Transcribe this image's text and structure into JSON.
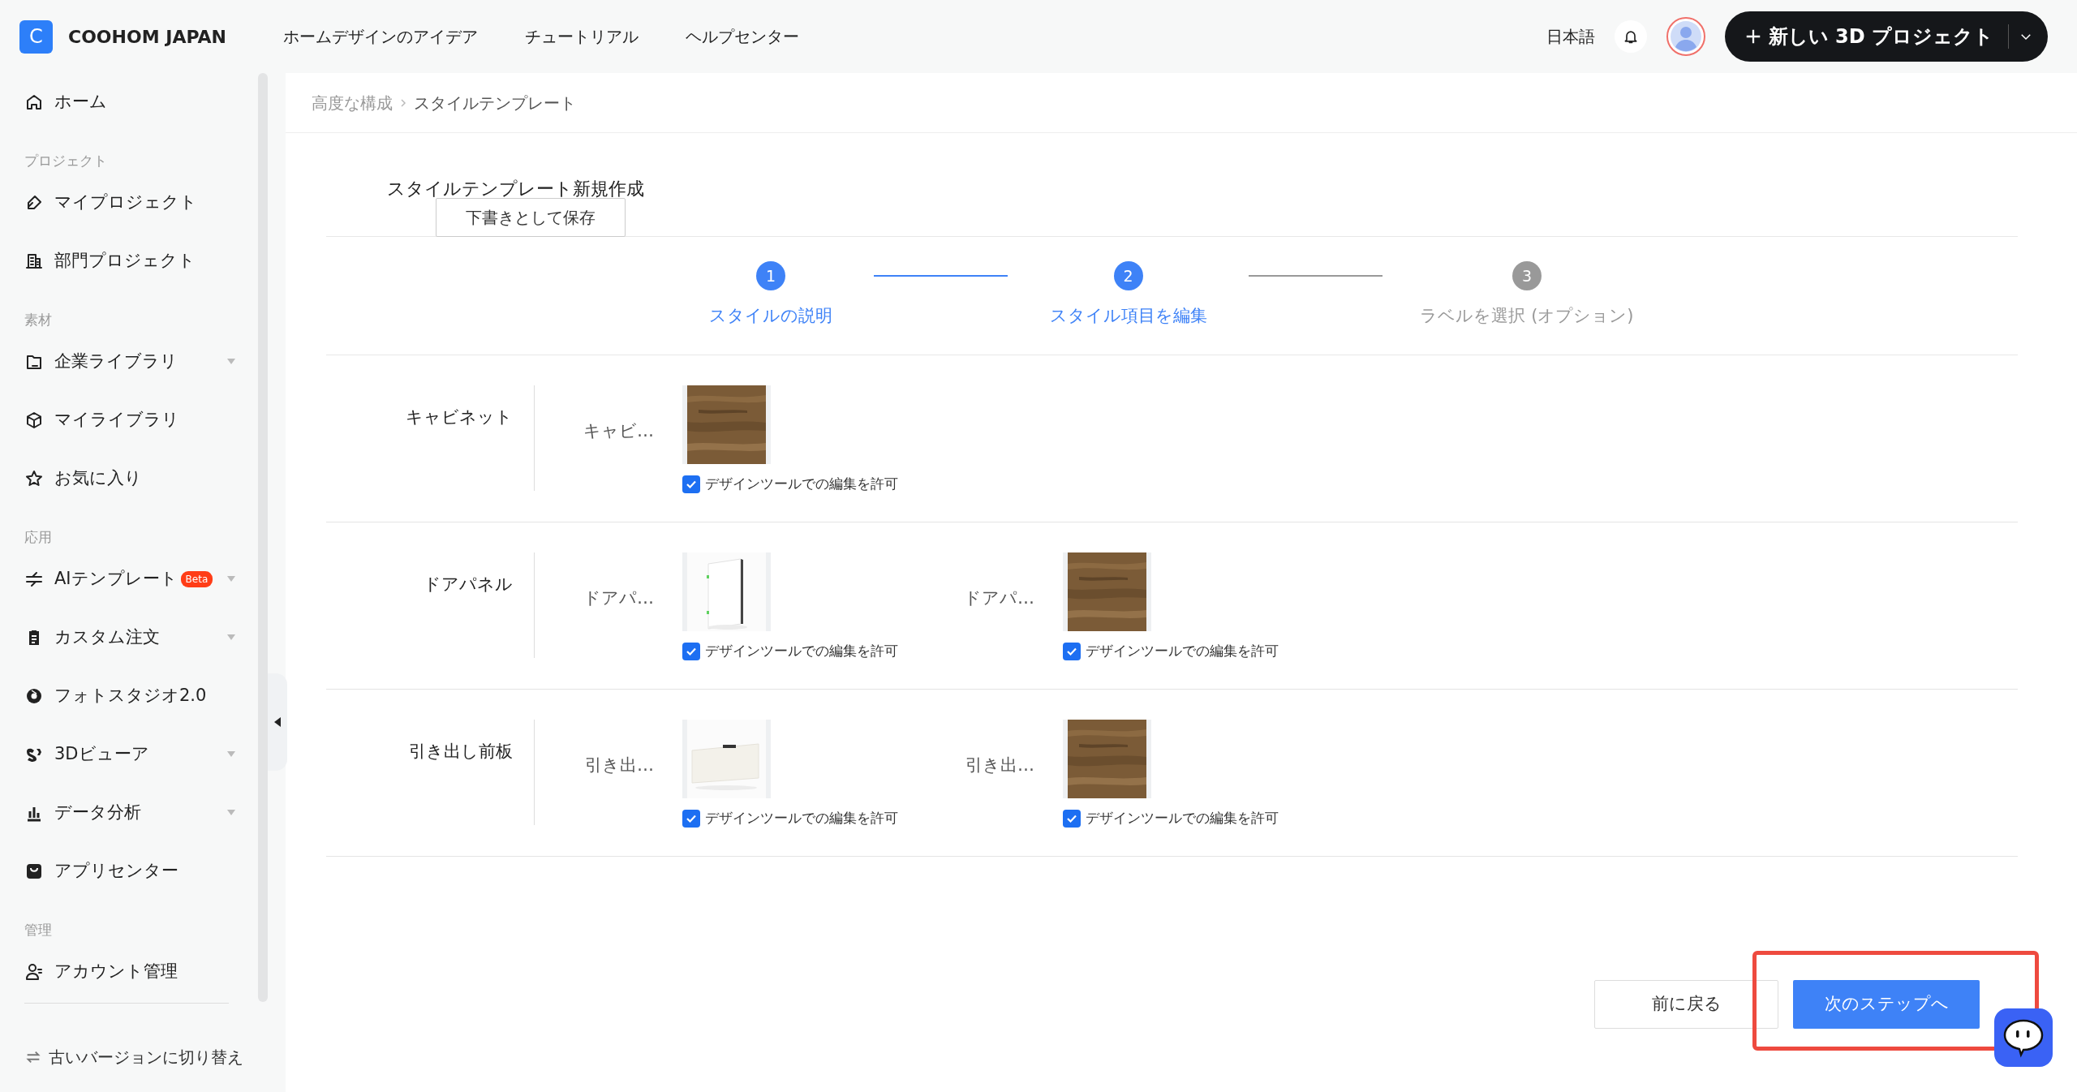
{
  "header": {
    "logo_letter": "C",
    "brand": "COOHOM JAPAN",
    "nav": [
      "ホームデザインのアイデア",
      "チュートリアル",
      "ヘルプセンター"
    ],
    "language": "日本語",
    "new_project_button": "新しい 3D プロジェクト"
  },
  "sidebar": {
    "entries": [
      {
        "kind": "item",
        "label": "ホーム",
        "dropdown": false
      },
      {
        "kind": "heading",
        "label": "プロジェクト"
      },
      {
        "kind": "item",
        "label": "マイプロジェクト",
        "dropdown": false
      },
      {
        "kind": "item",
        "label": "部門プロジェクト",
        "dropdown": false
      },
      {
        "kind": "heading",
        "label": "素材"
      },
      {
        "kind": "item",
        "label": "企業ライブラリ",
        "dropdown": true
      },
      {
        "kind": "item",
        "label": "マイライブラリ",
        "dropdown": false
      },
      {
        "kind": "item",
        "label": "お気に入り",
        "dropdown": false
      },
      {
        "kind": "heading",
        "label": "応用"
      },
      {
        "kind": "item",
        "label": "AIテンプレート",
        "badge": "Beta",
        "dropdown": true
      },
      {
        "kind": "item",
        "label": "カスタム注文",
        "dropdown": true
      },
      {
        "kind": "item",
        "label": "フォトスタジオ2.0",
        "dropdown": false
      },
      {
        "kind": "item",
        "label": "3Dビューア",
        "dropdown": true
      },
      {
        "kind": "item",
        "label": "データ分析",
        "dropdown": true
      },
      {
        "kind": "item",
        "label": "アプリセンター",
        "dropdown": false
      },
      {
        "kind": "heading",
        "label": "管理"
      },
      {
        "kind": "item",
        "label": "アカウント管理",
        "dropdown": false
      }
    ],
    "footer_link": "古いバージョンに切り替え"
  },
  "breadcrumb": [
    "高度な構成",
    "スタイルテンプレート"
  ],
  "page_title": "スタイルテンプレート新規作成",
  "save_draft_button": "下書きとして保存",
  "steps": [
    {
      "number": "1",
      "label": "スタイルの説明",
      "active": true
    },
    {
      "number": "2",
      "label": "スタイル項目を編集",
      "active": true
    },
    {
      "number": "3",
      "label": "ラベルを選択 (オプション)",
      "active": false
    }
  ],
  "groups": [
    {
      "name": "キャビネット",
      "items": [
        {
          "label": "キャビ…",
          "kind": "wood",
          "checkbox_label": "デザインツールでの編集を許可",
          "checked": true
        }
      ]
    },
    {
      "name": "ドアパネル",
      "items": [
        {
          "label": "ドアパ…",
          "kind": "door",
          "checkbox_label": "デザインツールでの編集を許可",
          "checked": true
        },
        {
          "label": "ドアパ…",
          "kind": "wood",
          "checkbox_label": "デザインツールでの編集を許可",
          "checked": true
        }
      ]
    },
    {
      "name": "引き出し前板",
      "items": [
        {
          "label": "引き出…",
          "kind": "drawer",
          "checkbox_label": "デザインツールでの編集を許可",
          "checked": true
        },
        {
          "label": "引き出…",
          "kind": "wood",
          "checkbox_label": "デザインツールでの編集を許可",
          "checked": true
        }
      ]
    }
  ],
  "footer_buttons": {
    "back": "前に戻る",
    "next": "次のステップへ",
    "next_highlighted": true
  }
}
